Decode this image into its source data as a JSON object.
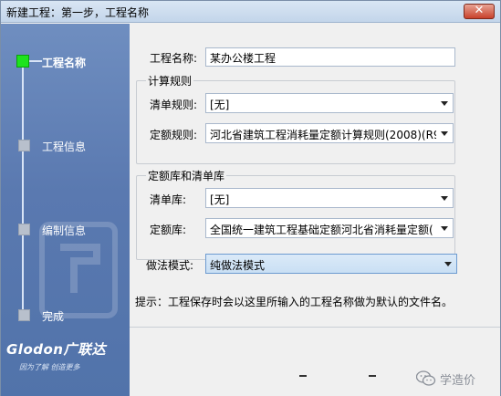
{
  "window": {
    "title": "新建工程：第一步，工程名称",
    "close_symbol": "✕"
  },
  "sidebar": {
    "steps": [
      {
        "label": "工程名称",
        "active": true
      },
      {
        "label": "工程信息",
        "active": false
      },
      {
        "label": "编制信息",
        "active": false
      },
      {
        "label": "完成",
        "active": false
      }
    ],
    "brand": {
      "logo": "Glodon广联达",
      "tagline": "因为了解  创造更多"
    }
  },
  "form": {
    "project_name": {
      "label": "工程名称:",
      "value": "某办公楼工程"
    },
    "calc_rules": {
      "title": "计算规则",
      "bill_rule": {
        "label": "清单规则:",
        "value": "[无]"
      },
      "quota_rule": {
        "label": "定额规则:",
        "value": "河北省建筑工程消耗量定额计算规则(2008)(R9"
      }
    },
    "libraries": {
      "title": "定额库和清单库",
      "bill_lib": {
        "label": "清单库:",
        "value": "[无]"
      },
      "quota_lib": {
        "label": "定额库:",
        "value": "全国统一建筑工程基础定额河北省消耗量定额("
      }
    },
    "method": {
      "label": "做法模式:",
      "value": "纯做法模式"
    },
    "hint": "提示：工程保存时会以这里所输入的工程名称做为默认的文件名。"
  },
  "watermark": {
    "text": "学造价",
    "icon": "wechat-icon"
  },
  "colors": {
    "sidebar": "#5a79b0",
    "active_step": "#1ee31e",
    "window_bg": "#f0f0f0"
  }
}
